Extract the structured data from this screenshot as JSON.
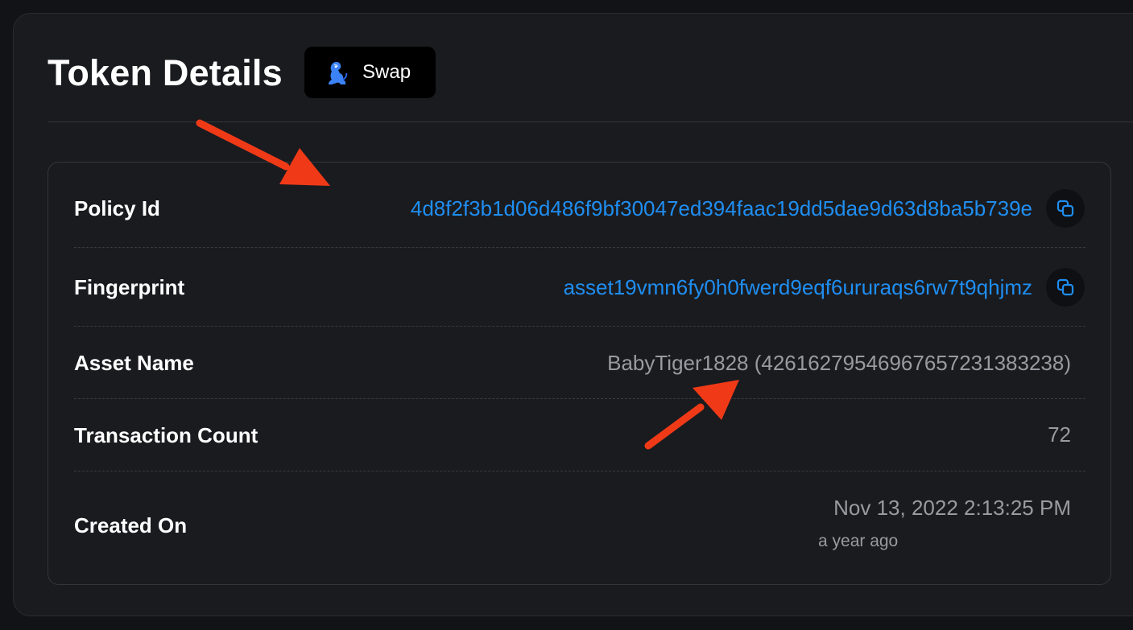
{
  "header": {
    "title": "Token Details",
    "swap_label": "Swap",
    "swap_icon": "dexhunter-dino-icon"
  },
  "details": {
    "policy_id": {
      "label": "Policy Id",
      "value": "4d8f2f3b1d06d486f9bf30047ed394faac19dd5dae9d63d8ba5b739e",
      "copy_icon": "copy-icon"
    },
    "fingerprint": {
      "label": "Fingerprint",
      "value": "asset19vmn6fy0h0fwerd9eqf6ururaqs6rw7t9qhjmz",
      "copy_icon": "copy-icon"
    },
    "asset_name": {
      "label": "Asset Name",
      "value": "BabyTiger1828 (426162795469676572313832 38)"
    },
    "transaction_count": {
      "label": "Transaction Count",
      "value": "72"
    },
    "created_on": {
      "label": "Created On",
      "value": "Nov 13, 2022 2:13:25 PM",
      "relative": "a year ago"
    }
  },
  "colors": {
    "link": "#1f8ef1",
    "annotation_arrow": "#f03a17"
  }
}
